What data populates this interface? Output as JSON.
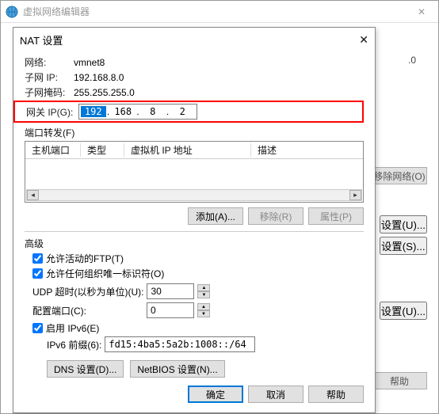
{
  "parent_window": {
    "title": "虚拟网络编辑器",
    "close": "✕",
    "side0": ".0",
    "btn_remove_net": "移除网络(O)",
    "btn_set_u": "设置(U)...",
    "btn_set_s": "设置(S)...",
    "btn_set_u2": "设置(U)...",
    "btn_help": "帮助"
  },
  "dialog": {
    "title": "NAT 设置",
    "close": "✕",
    "labels": {
      "network": "网络:",
      "subnet_ip": "子网 IP:",
      "subnet_mask": "子网掩码:",
      "gateway": "网关 IP(G):"
    },
    "values": {
      "network": "vmnet8",
      "subnet_ip": "192.168.8.0",
      "subnet_mask": "255.255.255.0",
      "gw": {
        "o1": "192",
        "o2": "168",
        "o3": "8",
        "o4": "2"
      }
    },
    "port_forward": {
      "title": "端口转发(F)",
      "headers": {
        "host": "主机端口",
        "type": "类型",
        "vm_ip": "虚拟机 IP 地址",
        "desc": "描述"
      },
      "buttons": {
        "add": "添加(A)...",
        "remove": "移除(R)",
        "props": "属性(P)"
      }
    },
    "advanced": {
      "title": "高级",
      "allow_active_ftp": "允许活动的FTP(T)",
      "allow_org_id": "允许任何组织唯一标识符(O)",
      "udp_timeout_label": "UDP 超时(以秒为单位)(U):",
      "udp_timeout_value": "30",
      "config_port_label": "配置端口(C):",
      "config_port_value": "0",
      "enable_ipv6": "启用 IPv6(E)",
      "ipv6_prefix_label": "IPv6 前缀(6):",
      "ipv6_prefix_value": "fd15:4ba5:5a2b:1008::/64"
    },
    "bottom_inner": {
      "dns": "DNS 设置(D)...",
      "netbios": "NetBIOS 设置(N)..."
    },
    "actions": {
      "ok": "确定",
      "cancel": "取消",
      "help": "帮助"
    }
  }
}
